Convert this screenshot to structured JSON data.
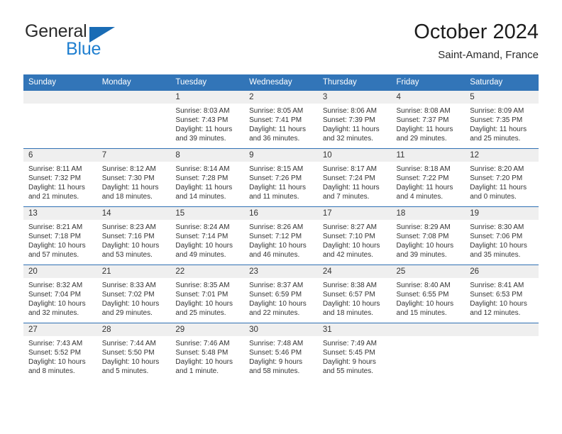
{
  "brand": {
    "name_top": "General",
    "name_bottom": "Blue",
    "accent_color": "#1f7fd0",
    "triangle_color": "#1a6cb5"
  },
  "header": {
    "title": "October 2024",
    "subtitle": "Saint-Amand, France"
  },
  "theme": {
    "header_row_bg": "#3275b8",
    "row_rule_color": "#2f70b3",
    "date_band_bg": "#efefef",
    "text_color": "#333333"
  },
  "weekdays": [
    "Sunday",
    "Monday",
    "Tuesday",
    "Wednesday",
    "Thursday",
    "Friday",
    "Saturday"
  ],
  "labels": {
    "sunrise_prefix": "Sunrise:",
    "sunset_prefix": "Sunset:",
    "daylight_prefix": "Daylight:"
  },
  "weeks": [
    [
      {
        "day": "",
        "empty": true
      },
      {
        "day": "",
        "empty": true
      },
      {
        "day": "1",
        "sunrise": "Sunrise: 8:03 AM",
        "sunset": "Sunset: 7:43 PM",
        "daylight_line1": "Daylight: 11 hours",
        "daylight_line2": "and 39 minutes."
      },
      {
        "day": "2",
        "sunrise": "Sunrise: 8:05 AM",
        "sunset": "Sunset: 7:41 PM",
        "daylight_line1": "Daylight: 11 hours",
        "daylight_line2": "and 36 minutes."
      },
      {
        "day": "3",
        "sunrise": "Sunrise: 8:06 AM",
        "sunset": "Sunset: 7:39 PM",
        "daylight_line1": "Daylight: 11 hours",
        "daylight_line2": "and 32 minutes."
      },
      {
        "day": "4",
        "sunrise": "Sunrise: 8:08 AM",
        "sunset": "Sunset: 7:37 PM",
        "daylight_line1": "Daylight: 11 hours",
        "daylight_line2": "and 29 minutes."
      },
      {
        "day": "5",
        "sunrise": "Sunrise: 8:09 AM",
        "sunset": "Sunset: 7:35 PM",
        "daylight_line1": "Daylight: 11 hours",
        "daylight_line2": "and 25 minutes."
      }
    ],
    [
      {
        "day": "6",
        "sunrise": "Sunrise: 8:11 AM",
        "sunset": "Sunset: 7:32 PM",
        "daylight_line1": "Daylight: 11 hours",
        "daylight_line2": "and 21 minutes."
      },
      {
        "day": "7",
        "sunrise": "Sunrise: 8:12 AM",
        "sunset": "Sunset: 7:30 PM",
        "daylight_line1": "Daylight: 11 hours",
        "daylight_line2": "and 18 minutes."
      },
      {
        "day": "8",
        "sunrise": "Sunrise: 8:14 AM",
        "sunset": "Sunset: 7:28 PM",
        "daylight_line1": "Daylight: 11 hours",
        "daylight_line2": "and 14 minutes."
      },
      {
        "day": "9",
        "sunrise": "Sunrise: 8:15 AM",
        "sunset": "Sunset: 7:26 PM",
        "daylight_line1": "Daylight: 11 hours",
        "daylight_line2": "and 11 minutes."
      },
      {
        "day": "10",
        "sunrise": "Sunrise: 8:17 AM",
        "sunset": "Sunset: 7:24 PM",
        "daylight_line1": "Daylight: 11 hours",
        "daylight_line2": "and 7 minutes."
      },
      {
        "day": "11",
        "sunrise": "Sunrise: 8:18 AM",
        "sunset": "Sunset: 7:22 PM",
        "daylight_line1": "Daylight: 11 hours",
        "daylight_line2": "and 4 minutes."
      },
      {
        "day": "12",
        "sunrise": "Sunrise: 8:20 AM",
        "sunset": "Sunset: 7:20 PM",
        "daylight_line1": "Daylight: 11 hours",
        "daylight_line2": "and 0 minutes."
      }
    ],
    [
      {
        "day": "13",
        "sunrise": "Sunrise: 8:21 AM",
        "sunset": "Sunset: 7:18 PM",
        "daylight_line1": "Daylight: 10 hours",
        "daylight_line2": "and 57 minutes."
      },
      {
        "day": "14",
        "sunrise": "Sunrise: 8:23 AM",
        "sunset": "Sunset: 7:16 PM",
        "daylight_line1": "Daylight: 10 hours",
        "daylight_line2": "and 53 minutes."
      },
      {
        "day": "15",
        "sunrise": "Sunrise: 8:24 AM",
        "sunset": "Sunset: 7:14 PM",
        "daylight_line1": "Daylight: 10 hours",
        "daylight_line2": "and 49 minutes."
      },
      {
        "day": "16",
        "sunrise": "Sunrise: 8:26 AM",
        "sunset": "Sunset: 7:12 PM",
        "daylight_line1": "Daylight: 10 hours",
        "daylight_line2": "and 46 minutes."
      },
      {
        "day": "17",
        "sunrise": "Sunrise: 8:27 AM",
        "sunset": "Sunset: 7:10 PM",
        "daylight_line1": "Daylight: 10 hours",
        "daylight_line2": "and 42 minutes."
      },
      {
        "day": "18",
        "sunrise": "Sunrise: 8:29 AM",
        "sunset": "Sunset: 7:08 PM",
        "daylight_line1": "Daylight: 10 hours",
        "daylight_line2": "and 39 minutes."
      },
      {
        "day": "19",
        "sunrise": "Sunrise: 8:30 AM",
        "sunset": "Sunset: 7:06 PM",
        "daylight_line1": "Daylight: 10 hours",
        "daylight_line2": "and 35 minutes."
      }
    ],
    [
      {
        "day": "20",
        "sunrise": "Sunrise: 8:32 AM",
        "sunset": "Sunset: 7:04 PM",
        "daylight_line1": "Daylight: 10 hours",
        "daylight_line2": "and 32 minutes."
      },
      {
        "day": "21",
        "sunrise": "Sunrise: 8:33 AM",
        "sunset": "Sunset: 7:02 PM",
        "daylight_line1": "Daylight: 10 hours",
        "daylight_line2": "and 29 minutes."
      },
      {
        "day": "22",
        "sunrise": "Sunrise: 8:35 AM",
        "sunset": "Sunset: 7:01 PM",
        "daylight_line1": "Daylight: 10 hours",
        "daylight_line2": "and 25 minutes."
      },
      {
        "day": "23",
        "sunrise": "Sunrise: 8:37 AM",
        "sunset": "Sunset: 6:59 PM",
        "daylight_line1": "Daylight: 10 hours",
        "daylight_line2": "and 22 minutes."
      },
      {
        "day": "24",
        "sunrise": "Sunrise: 8:38 AM",
        "sunset": "Sunset: 6:57 PM",
        "daylight_line1": "Daylight: 10 hours",
        "daylight_line2": "and 18 minutes."
      },
      {
        "day": "25",
        "sunrise": "Sunrise: 8:40 AM",
        "sunset": "Sunset: 6:55 PM",
        "daylight_line1": "Daylight: 10 hours",
        "daylight_line2": "and 15 minutes."
      },
      {
        "day": "26",
        "sunrise": "Sunrise: 8:41 AM",
        "sunset": "Sunset: 6:53 PM",
        "daylight_line1": "Daylight: 10 hours",
        "daylight_line2": "and 12 minutes."
      }
    ],
    [
      {
        "day": "27",
        "sunrise": "Sunrise: 7:43 AM",
        "sunset": "Sunset: 5:52 PM",
        "daylight_line1": "Daylight: 10 hours",
        "daylight_line2": "and 8 minutes."
      },
      {
        "day": "28",
        "sunrise": "Sunrise: 7:44 AM",
        "sunset": "Sunset: 5:50 PM",
        "daylight_line1": "Daylight: 10 hours",
        "daylight_line2": "and 5 minutes."
      },
      {
        "day": "29",
        "sunrise": "Sunrise: 7:46 AM",
        "sunset": "Sunset: 5:48 PM",
        "daylight_line1": "Daylight: 10 hours",
        "daylight_line2": "and 1 minute."
      },
      {
        "day": "30",
        "sunrise": "Sunrise: 7:48 AM",
        "sunset": "Sunset: 5:46 PM",
        "daylight_line1": "Daylight: 9 hours",
        "daylight_line2": "and 58 minutes."
      },
      {
        "day": "31",
        "sunrise": "Sunrise: 7:49 AM",
        "sunset": "Sunset: 5:45 PM",
        "daylight_line1": "Daylight: 9 hours",
        "daylight_line2": "and 55 minutes."
      },
      {
        "day": "",
        "empty": true
      },
      {
        "day": "",
        "empty": true
      }
    ]
  ]
}
